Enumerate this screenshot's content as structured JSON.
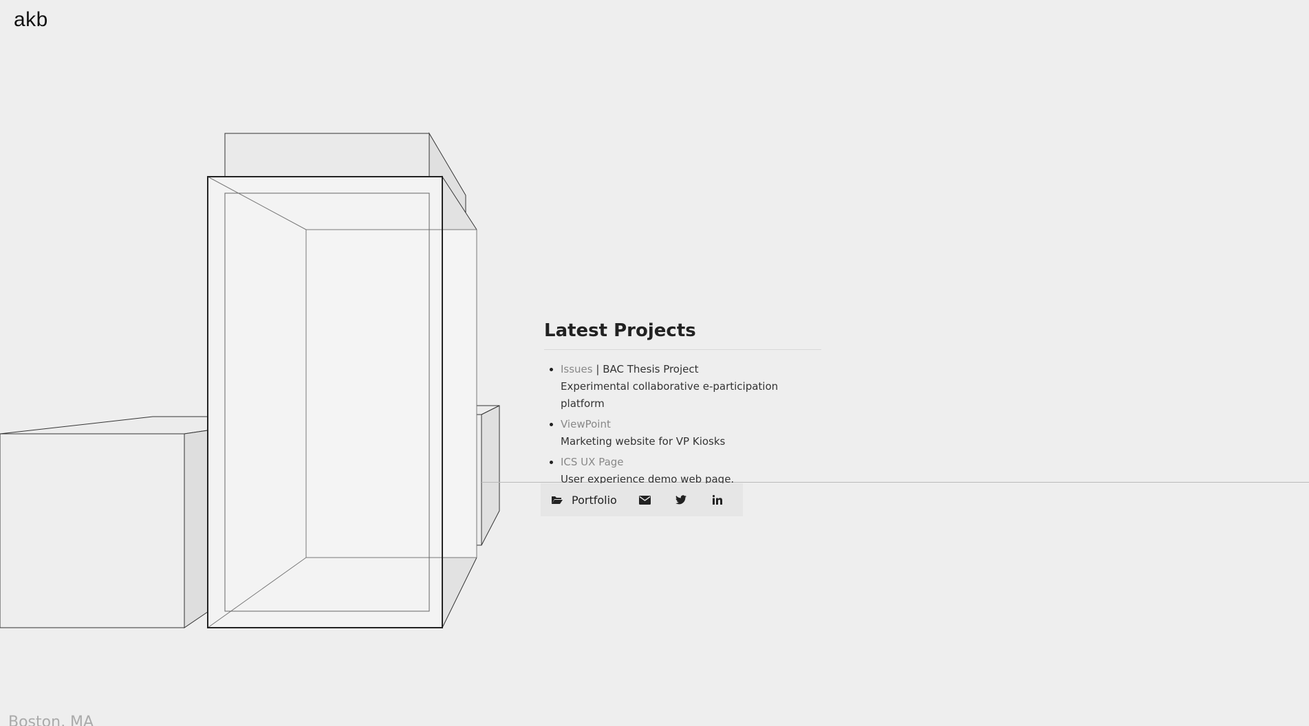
{
  "site": {
    "logo": "akb",
    "location": "Boston, MA"
  },
  "projects": {
    "heading": "Latest Projects",
    "items": [
      {
        "link": "Issues",
        "suffix": " | BAC Thesis Project",
        "description": "Experimental collaborative e-participation platform"
      },
      {
        "link": "ViewPoint",
        "suffix": "",
        "description": "Marketing website for VP Kiosks"
      },
      {
        "link": "ICS UX Page",
        "suffix": "",
        "description": "User experience demo web page."
      }
    ]
  },
  "social": {
    "portfolio_label": "Portfolio",
    "icons": [
      "folder-open-icon",
      "envelope-icon",
      "twitter-icon",
      "linkedin-icon"
    ]
  },
  "colors": {
    "background": "#eeeeee",
    "link": "#888888",
    "text": "#222222"
  }
}
